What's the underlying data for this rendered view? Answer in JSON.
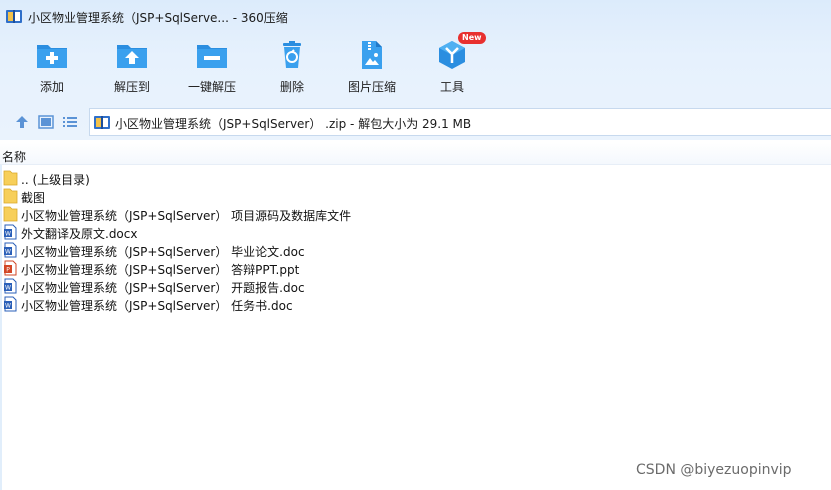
{
  "window": {
    "title": "小区物业管理系统（JSP+SqlServe... - 360压缩"
  },
  "toolbar": {
    "items": [
      {
        "label": "添加",
        "icon": "add-folder-icon"
      },
      {
        "label": "解压到",
        "icon": "extract-to-icon"
      },
      {
        "label": "一键解压",
        "icon": "one-click-extract-icon"
      },
      {
        "label": "删除",
        "icon": "trash-icon"
      },
      {
        "label": "图片压缩",
        "icon": "image-compress-icon"
      },
      {
        "label": "工具",
        "icon": "tools-icon",
        "badge": "New"
      }
    ]
  },
  "address": {
    "text": "小区物业管理系统（JSP+SqlServer） .zip - 解包大小为 29.1 MB"
  },
  "list": {
    "column_name": "名称",
    "items": [
      {
        "name": ".. (上级目录)",
        "type": "folder"
      },
      {
        "name": "截图",
        "type": "folder"
      },
      {
        "name": "小区物业管理系统（JSP+SqlServer） 项目源码及数据库文件",
        "type": "folder"
      },
      {
        "name": "外文翻译及原文.docx",
        "type": "word"
      },
      {
        "name": "小区物业管理系统（JSP+SqlServer） 毕业论文.doc",
        "type": "word"
      },
      {
        "name": "小区物业管理系统（JSP+SqlServer） 答辩PPT.ppt",
        "type": "ppt"
      },
      {
        "name": "小区物业管理系统（JSP+SqlServer） 开题报告.doc",
        "type": "word"
      },
      {
        "name": "小区物业管理系统（JSP+SqlServer） 任务书.doc",
        "type": "word"
      }
    ]
  },
  "watermark": "CSDN @biyezuopinvip",
  "colors": {
    "accent_blue": "#2b8ee0",
    "folder_yellow": "#f7cf5a",
    "badge_red": "#e8302f",
    "word_blue": "#2a5fb8",
    "ppt_orange": "#d24625"
  }
}
